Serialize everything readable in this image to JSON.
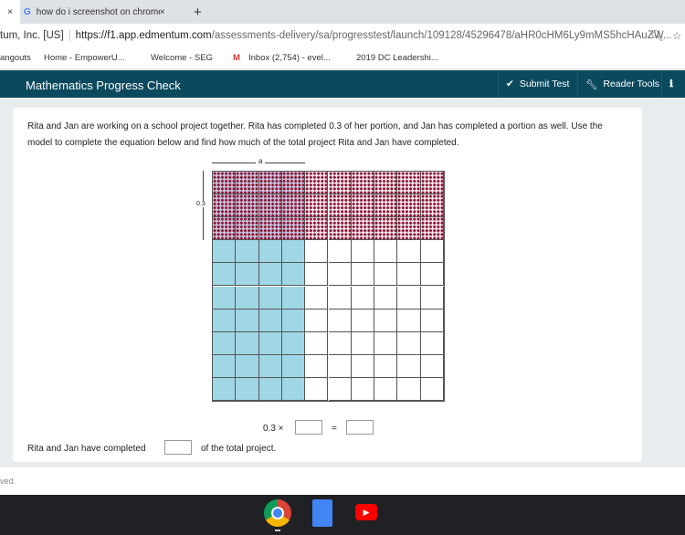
{
  "browser": {
    "tab_close": "×",
    "tab_title": "how do i screenshot on chromeb",
    "new_tab": "+",
    "site_label": "tum, Inc. [US]",
    "url_host": "https://f1.app.edmentum.com",
    "url_path": "/assessments-delivery/sa/progresstest/launch/109128/45296478/aHR0cHM6Ly9mMS5hcHAuZW...",
    "bookmarks": [
      "angouts",
      "Home - EmpowerU...",
      "Welcome - SEG",
      "Inbox (2,754) - evel...",
      "2019 DC Leadershi..."
    ]
  },
  "app": {
    "title": "Mathematics Progress Check",
    "submit": "Submit Test",
    "reader": "Reader Tools"
  },
  "question": {
    "text": "Rita and Jan are working on a school project together.  Rita has completed 0.3 of her portion, and Jan has completed a portion as well.  Use the model to complete the equation below and find how much of the total project Rita and Jan have completed.",
    "label_a": "a",
    "label_03": "0.3",
    "eq_left": "0.3 ×",
    "eq_equals": "=",
    "eq_blank1": "",
    "eq_blank2": "",
    "sentence_start": "Rita and Jan have completed",
    "sentence_blank": "",
    "sentence_end": "of the total project."
  },
  "model": {
    "rows": 10,
    "cols": 10,
    "blue_cols": 4,
    "dotted_rows": 3,
    "colors": {
      "blue": "#9fd7e6",
      "dots": "#8a1330"
    }
  },
  "footer": {
    "status": "ved."
  },
  "taskbar": {
    "apps": [
      "chrome-icon",
      "docs-icon",
      "youtube-icon"
    ]
  }
}
